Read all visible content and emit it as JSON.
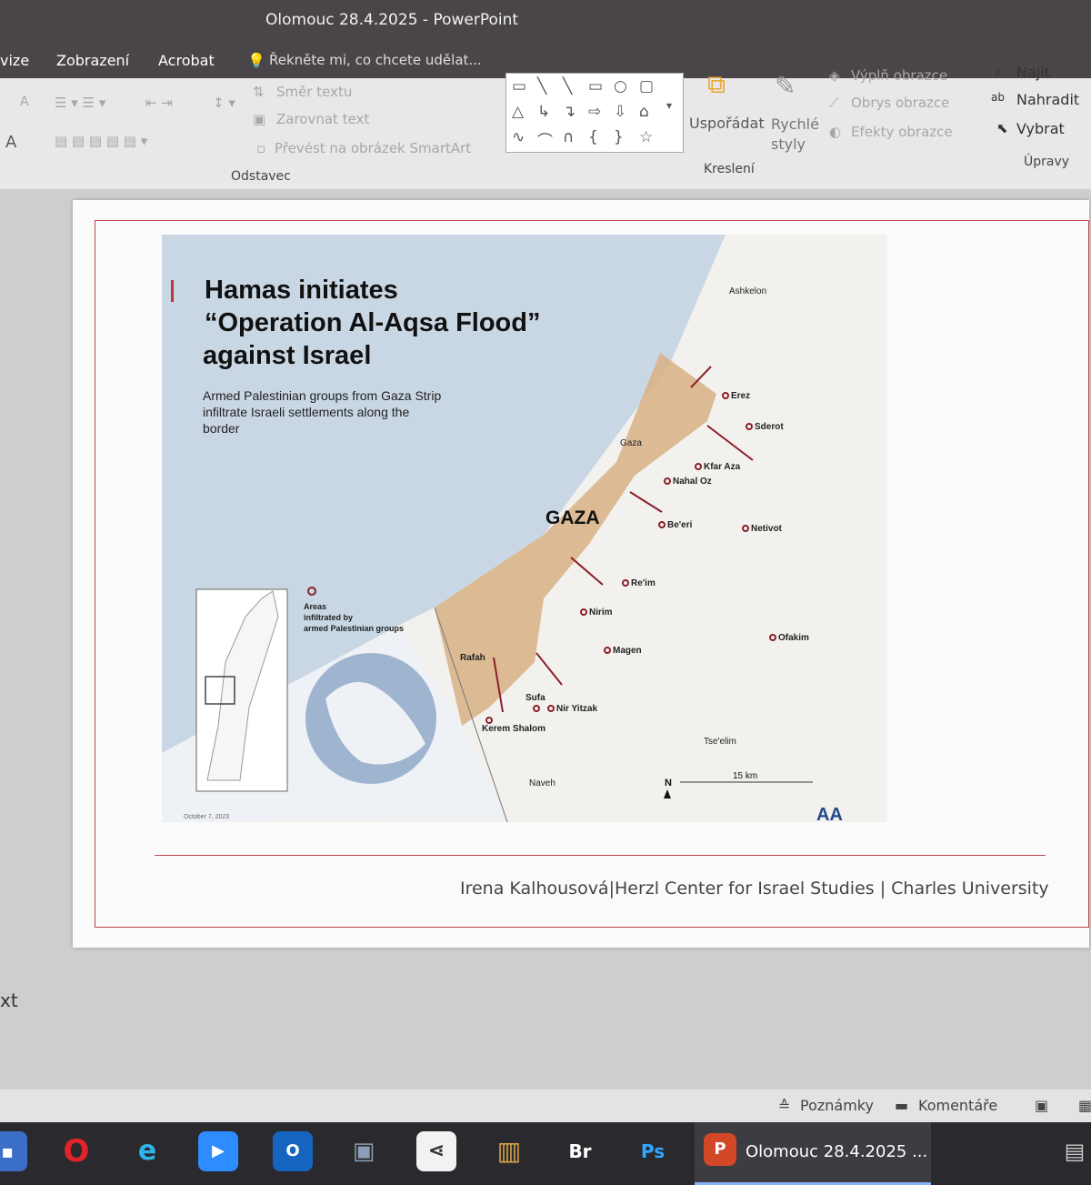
{
  "window": {
    "title": "Olomouc 28.4.2025 - PowerPoint"
  },
  "menu": {
    "items": [
      "vize",
      "Zobrazení",
      "Acrobat"
    ],
    "tell_me": "Řekněte mi, co chcete udělat..."
  },
  "ribbon": {
    "paragraph": {
      "text_direction": "Směr textu",
      "align_text": "Zarovnat text",
      "smartart": "Převést na obrázek SmartArt",
      "group_label": "Odstavec",
      "font_a": "A"
    },
    "drawing": {
      "arrange": "Uspořádat",
      "quick_styles": "Rychlé styly",
      "fill": "Výplň obrazce",
      "outline": "Obrys obrazce",
      "effects": "Efekty obrazce",
      "group_label": "Kreslení"
    },
    "editing": {
      "find": "Najít",
      "replace": "Nahradit",
      "select": "Vybrat",
      "group_label": "Úpravy"
    }
  },
  "slide": {
    "title_line1": "Hamas initiates",
    "title_line2": "“Operation Al-Aqsa Flood”",
    "title_line3": "against Israel",
    "subtitle_line1": "Armed Palestinian groups from Gaza Strip",
    "subtitle_line2": "infiltrate Israeli settlements along the",
    "subtitle_line3": "border",
    "legend_line1": "Areas",
    "legend_line2": "infiltrated by",
    "legend_line3": "armed Palestinian groups",
    "gaza_label": "GAZA",
    "map_date": "October 7, 2023",
    "scale_label": "15 km",
    "north_label": "N",
    "logo": "AA",
    "places": {
      "ashkelon": "Ashkelon",
      "erez": "Erez",
      "sderot": "Sderot",
      "gaza": "Gaza",
      "kfar_aza": "Kfar Aza",
      "nahal_oz": "Nahal Oz",
      "beeri": "Be'eri",
      "netivot": "Netivot",
      "reim": "Re'im",
      "nirim": "Nirim",
      "magen": "Magen",
      "ofakim": "Ofakim",
      "rafah": "Rafah",
      "sufa": "Sufa",
      "nir_yitzhak": "Nir Yitzak",
      "kerem_shalom": "Kerem Shalom",
      "tseelim": "Tse'elim",
      "naveh": "Naveh"
    },
    "footer": "Irena Kalhousová|Herzl Center for Israel Studies | Charles University"
  },
  "status": {
    "notes": "Poznámky",
    "comments": "Komentáře",
    "left_text": "xt"
  },
  "taskbar": {
    "active_label": "Olomouc 28.4.2025 ...",
    "br": "Br",
    "ps": "Ps"
  },
  "colors": {
    "accent": "#b83a3a",
    "sea": "#c9d7e4",
    "gaza": "#d8b48a",
    "taskbar": "#2a2a2e"
  }
}
